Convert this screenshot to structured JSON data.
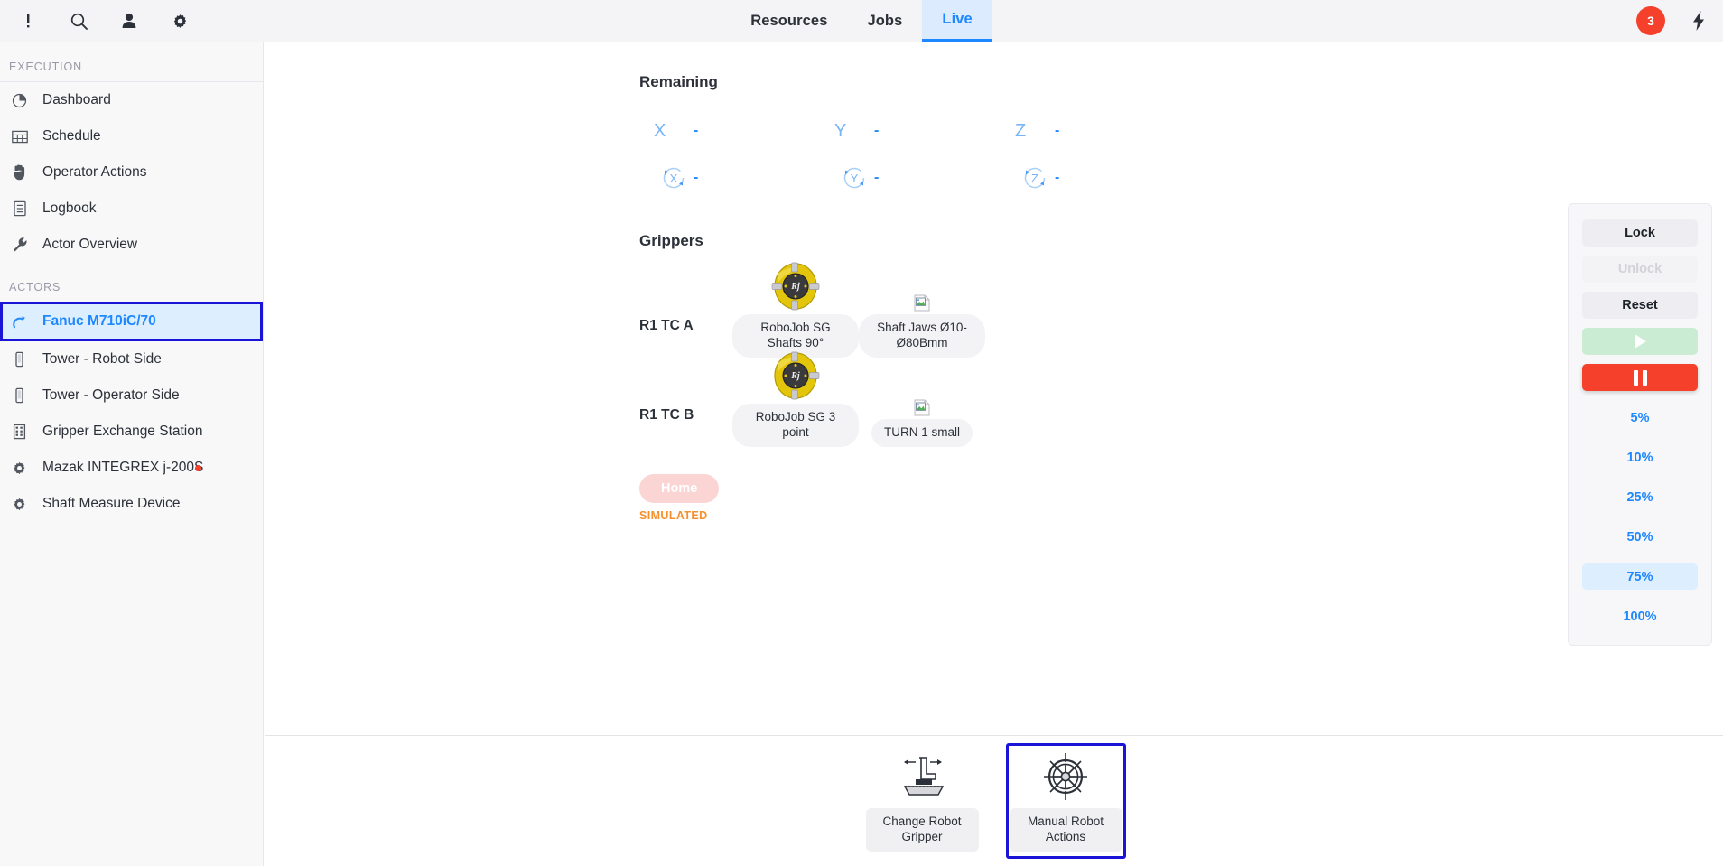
{
  "topbar": {
    "icons": [
      {
        "name": "alert-icon",
        "glyph": "!"
      },
      {
        "name": "search-icon",
        "glyph": "search"
      },
      {
        "name": "user-icon",
        "glyph": "person"
      },
      {
        "name": "settings-icon",
        "glyph": "gear"
      }
    ],
    "tabs": [
      {
        "label": "Resources",
        "active": false
      },
      {
        "label": "Jobs",
        "active": false
      },
      {
        "label": "Live",
        "active": true
      }
    ],
    "notification_count": "3",
    "notification_color": "#f5402c",
    "power_icon": "lightning-bolt-icon"
  },
  "sidebar": {
    "section_execution": "EXECUTION",
    "execution_items": [
      {
        "label": "Dashboard",
        "icon": "pie-chart-icon"
      },
      {
        "label": "Schedule",
        "icon": "table-icon"
      },
      {
        "label": "Operator Actions",
        "icon": "hand-icon"
      },
      {
        "label": "Logbook",
        "icon": "clipboard-icon"
      },
      {
        "label": "Actor Overview",
        "icon": "wrench-icon"
      }
    ],
    "section_actors": "ACTORS",
    "actor_items": [
      {
        "label": "Fanuc M710iC/70",
        "icon": "robot-arm-icon",
        "selected": true,
        "alert": false
      },
      {
        "label": "Tower - Robot Side",
        "icon": "tower-icon",
        "selected": false,
        "alert": false
      },
      {
        "label": "Tower - Operator Side",
        "icon": "tower-icon",
        "selected": false,
        "alert": false
      },
      {
        "label": "Gripper Exchange Station",
        "icon": "rack-icon",
        "selected": false,
        "alert": false
      },
      {
        "label": "Mazak INTEGREX j-200S",
        "icon": "gear-icon",
        "selected": false,
        "alert": true
      },
      {
        "label": "Shaft Measure Device",
        "icon": "gear-icon",
        "selected": false,
        "alert": false
      }
    ]
  },
  "main": {
    "remaining_title": "Remaining",
    "axes_linear": [
      {
        "label": "X",
        "value": "-"
      },
      {
        "label": "Y",
        "value": "-"
      },
      {
        "label": "Z",
        "value": "-"
      }
    ],
    "axes_rotational": [
      {
        "label": "X",
        "value": "-"
      },
      {
        "label": "Y",
        "value": "-"
      },
      {
        "label": "Z",
        "value": "-"
      }
    ],
    "grippers_title": "Grippers",
    "gripper_rows": [
      {
        "side": "R1 TC A",
        "items": [
          {
            "label": "RoboJob SG Shafts 90°",
            "image": "gripper-photo"
          },
          {
            "label": "Shaft Jaws Ø10-Ø80Bmm",
            "image": "broken-image-icon"
          }
        ]
      },
      {
        "side": "R1 TC B",
        "items": [
          {
            "label": "RoboJob SG 3 point",
            "image": "gripper-photo"
          },
          {
            "label": "TURN 1 small",
            "image": "broken-image-icon"
          }
        ]
      }
    ],
    "home_button": "Home",
    "simulated_label": "SIMULATED",
    "simulated_color": "#f5902c"
  },
  "control_panel": {
    "buttons": [
      {
        "label": "Lock",
        "state": "enabled"
      },
      {
        "label": "Unlock",
        "state": "disabled"
      },
      {
        "label": "Reset",
        "state": "enabled"
      }
    ],
    "play_icon": "play-icon",
    "play_state": "disabled",
    "pause_icon": "pause-icon",
    "pause_state": "active",
    "speeds": [
      {
        "label": "5%",
        "selected": false
      },
      {
        "label": "10%",
        "selected": false
      },
      {
        "label": "25%",
        "selected": false
      },
      {
        "label": "50%",
        "selected": false
      },
      {
        "label": "75%",
        "selected": true
      },
      {
        "label": "100%",
        "selected": false
      }
    ]
  },
  "bottombar": {
    "actions": [
      {
        "label": "Change Robot Gripper",
        "icon": "gripper-change-icon",
        "focused": false
      },
      {
        "label": "Manual Robot Actions",
        "icon": "ship-wheel-icon",
        "focused": true
      }
    ]
  }
}
